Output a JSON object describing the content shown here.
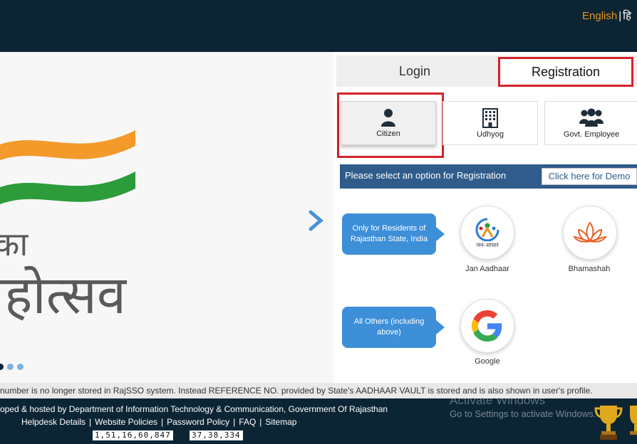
{
  "header": {
    "lang_english": "English",
    "lang_separator": "|",
    "lang_hindi": "हि"
  },
  "hero": {
    "line1": "का",
    "line2": "महोत्सव",
    "next_icon": "chevron-right-icon",
    "carousel_dots": 3,
    "active_dot": 0,
    "colors": {
      "saffron": "#f39a2a",
      "green": "#2c9b3a",
      "arrow": "#4a90d9"
    }
  },
  "tabs": {
    "login": "Login",
    "registration": "Registration",
    "active": "Registration",
    "highlight_color": "#d6212a"
  },
  "registration_types": [
    {
      "label": "Citizen",
      "icon": "user-icon",
      "selected": true
    },
    {
      "label": "Udhyog",
      "icon": "building-icon",
      "selected": false
    },
    {
      "label": "Govt. Employee",
      "icon": "users-group-icon",
      "selected": false
    }
  ],
  "select_bar": {
    "text": "Please select an option for Registration",
    "demo_button": "Click here for Demo",
    "color": "#2f5c8a"
  },
  "options": {
    "residents_bubble": "Only for Residents of Rajasthan State, India",
    "others_bubble": "All Others (including above)",
    "jan_aadhaar_label": "Jan Aadhaar",
    "jan_aadhaar_logo_text": "जन-आधार",
    "bhamashah_label": "Bhamashah",
    "google_label": "Google"
  },
  "notice": {
    "text": "number is no longer stored in RajSSO system. Instead REFERENCE NO. provided by State's AADHAAR VAULT is stored and is also shown in user's profile."
  },
  "footer": {
    "developed_by": "oped & hosted by Department of Information Technology & Communication, Government Of Rajasthan",
    "links": [
      "Helpdesk Details",
      "Website Policies",
      "Password Policy",
      "FAQ",
      "Sitemap"
    ],
    "counter_total": "1,51,16,60,847",
    "counter_today": "37,38,334",
    "watermark_title": "Activate Windows",
    "watermark_sub": "Go to Settings to activate Windows."
  }
}
